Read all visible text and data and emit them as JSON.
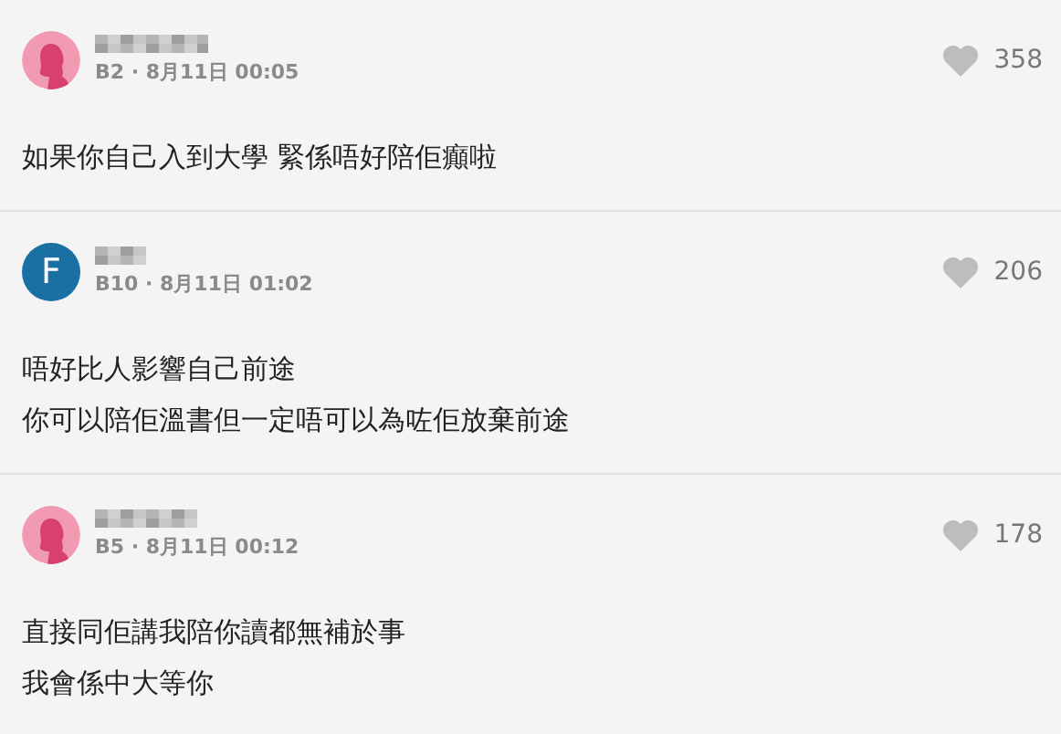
{
  "comments": [
    {
      "avatar": {
        "kind": "female"
      },
      "meta": "B2 · 8月11日 00:05",
      "likes": "358",
      "lines": [
        "如果你自己入到大學 緊係唔好陪佢癲啦"
      ]
    },
    {
      "avatar": {
        "kind": "letter",
        "letter": "F"
      },
      "meta": "B10 · 8月11日 01:02",
      "likes": "206",
      "lines": [
        "唔好比人影響自己前途",
        "你可以陪佢溫書但一定唔可以為咗佢放棄前途"
      ]
    },
    {
      "avatar": {
        "kind": "female"
      },
      "meta": "B5 · 8月11日 00:12",
      "likes": "178",
      "lines": [
        "直接同佢講我陪你讀都無補於事",
        "我會係中大等你"
      ]
    }
  ]
}
